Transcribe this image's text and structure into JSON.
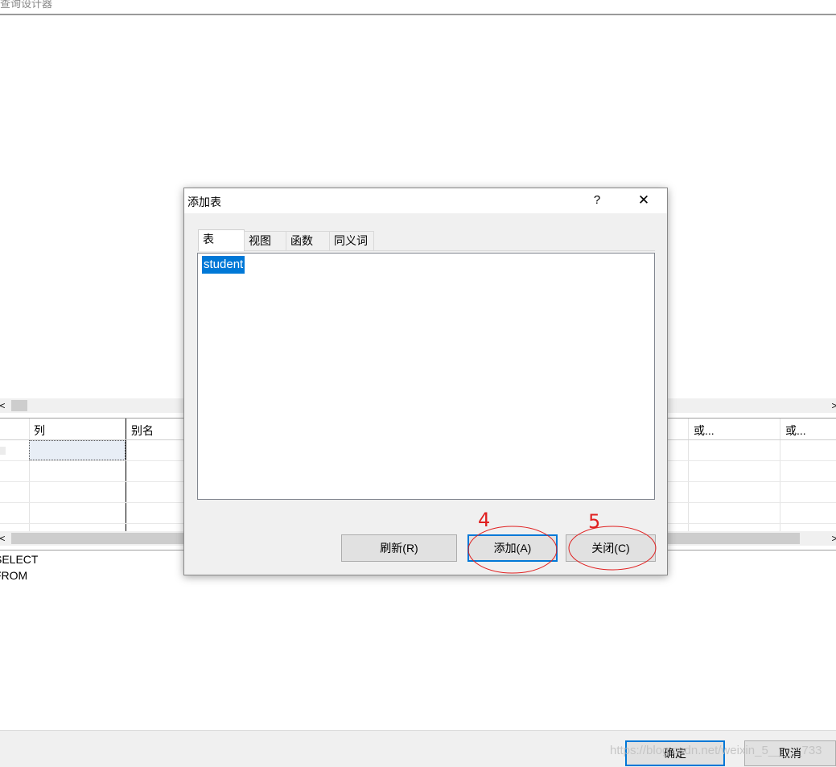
{
  "window": {
    "title": "查询设计器"
  },
  "grid": {
    "headers": [
      "列",
      "别名",
      "或...",
      "或..."
    ]
  },
  "sql": {
    "lines": [
      "SELECT",
      "FROM"
    ]
  },
  "bottom": {
    "ok_label": "确定",
    "cancel_label": "取消"
  },
  "watermark": "https://blog.csdn.net/weixin_5_____733",
  "dialog": {
    "title": "添加表",
    "help_glyph": "?",
    "close_glyph": "✕",
    "tabs": [
      "表",
      "视图",
      "函数",
      "同义词"
    ],
    "active_tab": 0,
    "list_items": [
      "student"
    ],
    "selected_item": 0,
    "buttons": {
      "refresh": "刷新(R)",
      "add": "添加(A)",
      "close": "关闭(C)"
    }
  },
  "annotations": {
    "step_add": "4",
    "step_close": "5",
    "color": "#e02020"
  },
  "colors": {
    "selection": "#0078d7",
    "dialog_bg": "#f0f0f0"
  }
}
